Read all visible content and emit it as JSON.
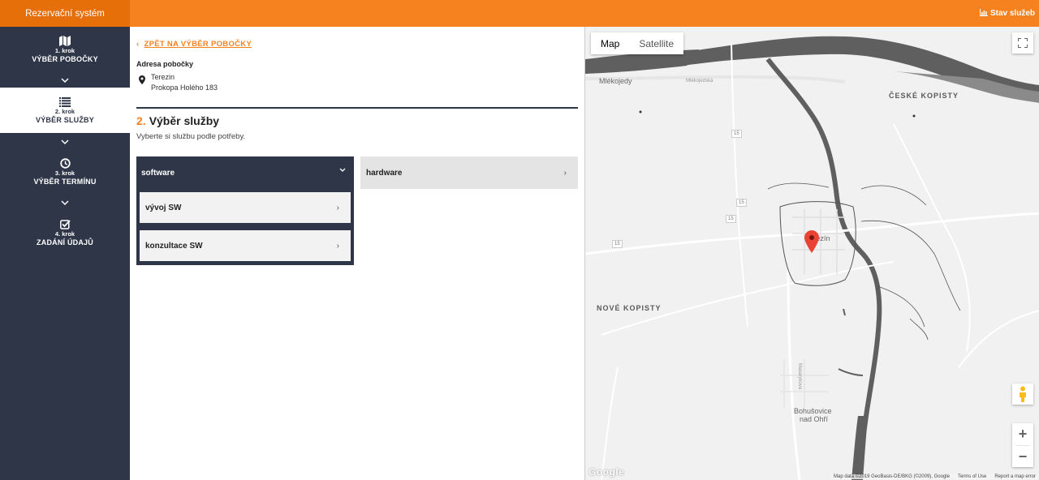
{
  "header": {
    "brand": "Rezervační systém",
    "status_link": "Stav služeb"
  },
  "sidebar": {
    "steps": [
      {
        "num": "1. krok",
        "label": "VÝBĚR POBOČKY",
        "icon": "map-icon"
      },
      {
        "num": "2. krok",
        "label": "VÝBĚR SLUŽBY",
        "icon": "list-icon"
      },
      {
        "num": "3. krok",
        "label": "VÝBĚR TERMÍNU",
        "icon": "clock-icon"
      },
      {
        "num": "4. krok",
        "label": "ZADÁNÍ ÚDAJŮ",
        "icon": "checkbox-icon"
      }
    ]
  },
  "content": {
    "back_link": "ZPĚT NA VÝBĚR POBOČKY",
    "address_label": "Adresa pobočky",
    "address_lines": [
      "Terezin",
      "Prokopa Holého 183"
    ],
    "section_number": "2.",
    "section_title": "Výběr služby",
    "subtitle": "Vyberte si službu podle potřeby.",
    "categories": [
      {
        "label": "software",
        "expanded": true,
        "items": [
          "vývoj SW",
          "konzultace SW"
        ]
      },
      {
        "label": "hardware",
        "expanded": false,
        "items": []
      }
    ]
  },
  "map": {
    "type_buttons": [
      "Map",
      "Satellite"
    ],
    "selected_type": "Map",
    "labels": {
      "mlekojedy": "Mlékojedy",
      "mlekojedska": "Mlékojedská",
      "ceske_kopisty": "ČESKÉ KOPISTY",
      "nove_kopisty": "NOVÉ KOPISTY",
      "terezin": "Terezín",
      "bohusovice_1": "Bohušovice",
      "bohusovice_2": "nad Ohří",
      "masarykova": "Masarykova",
      "road_15a": "15",
      "road_15b": "15",
      "road_15c": "15",
      "road_15d": "15"
    },
    "zoom_in": "+",
    "zoom_out": "−",
    "logo": "Google",
    "attribution": [
      "Map data ©2019 GeoBasis-DE/BKG (©2009), Google",
      "Terms of Use",
      "Report a map error"
    ]
  },
  "colors": {
    "accent": "#f5821f",
    "sidebar": "#2e3648",
    "marker": "#ea4335"
  }
}
